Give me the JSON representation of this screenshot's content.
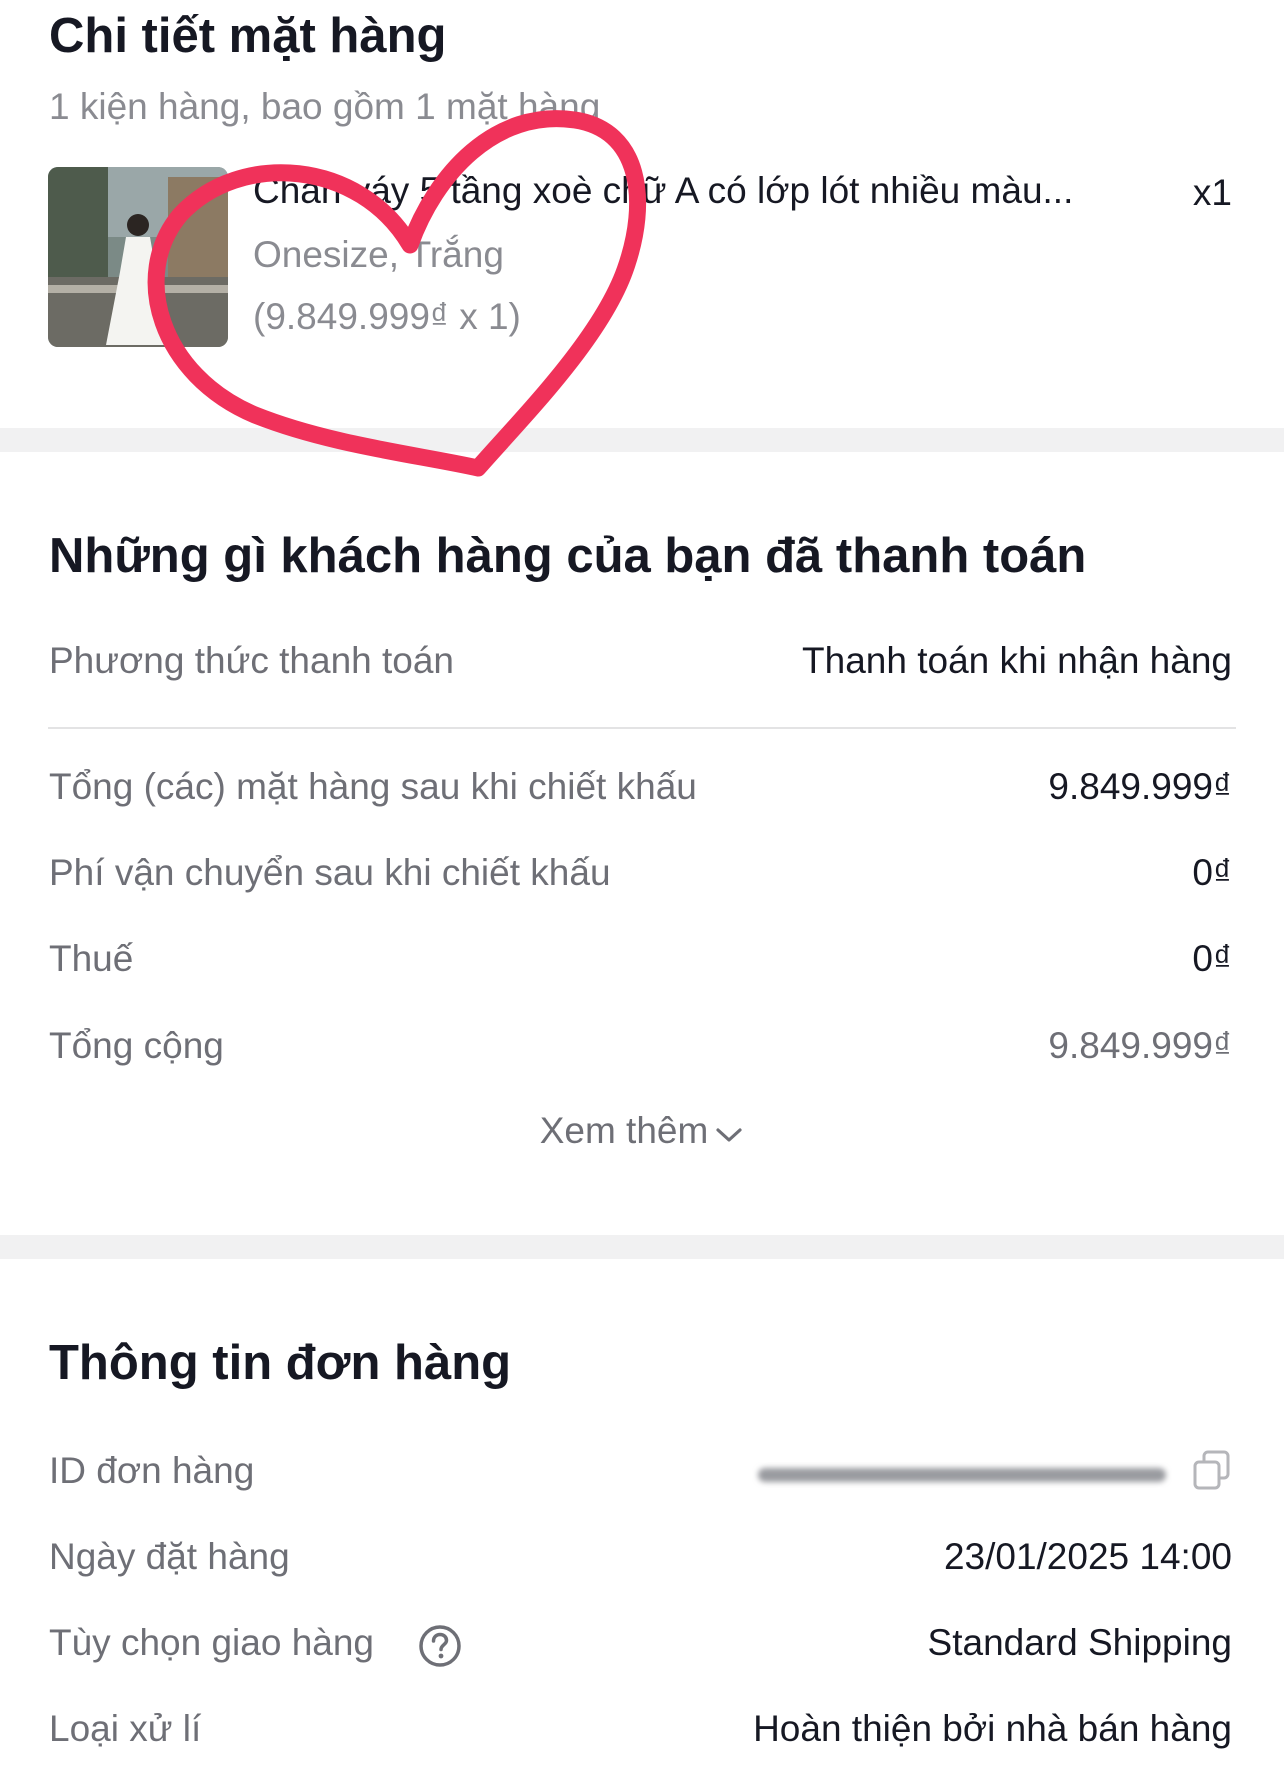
{
  "item_details": {
    "title": "Chi tiết mặt hàng",
    "summary": "1 kiện hàng, bao gồm 1 mặt hàng",
    "product": {
      "name": "Chân váy 5 tầng xoè chữ A có lớp lót nhiều màu...",
      "quantity": "x1",
      "variant": "Onesize, Trắng",
      "unit_price": "(9.849.999₫ x 1)"
    }
  },
  "payment": {
    "title": "Những gì khách hàng của bạn đã thanh toán",
    "method_label": "Phương thức thanh toán",
    "method_value": "Thanh toán khi nhận hàng",
    "rows": [
      {
        "label": "Tổng (các) mặt hàng sau khi chiết khấu",
        "value": "9.849.999₫"
      },
      {
        "label": "Phí vận chuyển sau khi chiết khấu",
        "value": "0₫"
      },
      {
        "label": "Thuế",
        "value": "0₫"
      },
      {
        "label": "Tổng cộng",
        "value": "9.849.999₫"
      }
    ],
    "see_more": "Xem thêm"
  },
  "order_info": {
    "title": "Thông tin đơn hàng",
    "rows": [
      {
        "label": "ID đơn hàng",
        "value": ""
      },
      {
        "label": "Ngày đặt hàng",
        "value": "23/01/2025 14:00"
      },
      {
        "label": "Tùy chọn giao hàng",
        "value": "Standard Shipping"
      },
      {
        "label": "Loại xử lí",
        "value": "Hoàn thiện bởi nhà bán hàng"
      }
    ]
  },
  "colors": {
    "text_primary": "#161823",
    "text_secondary": "#8a8b91",
    "separator": "#f1f1f2",
    "heart_annotation": "#f0325a"
  },
  "icons": [
    "chevron-down-icon",
    "copy-icon",
    "help-circle-icon"
  ]
}
